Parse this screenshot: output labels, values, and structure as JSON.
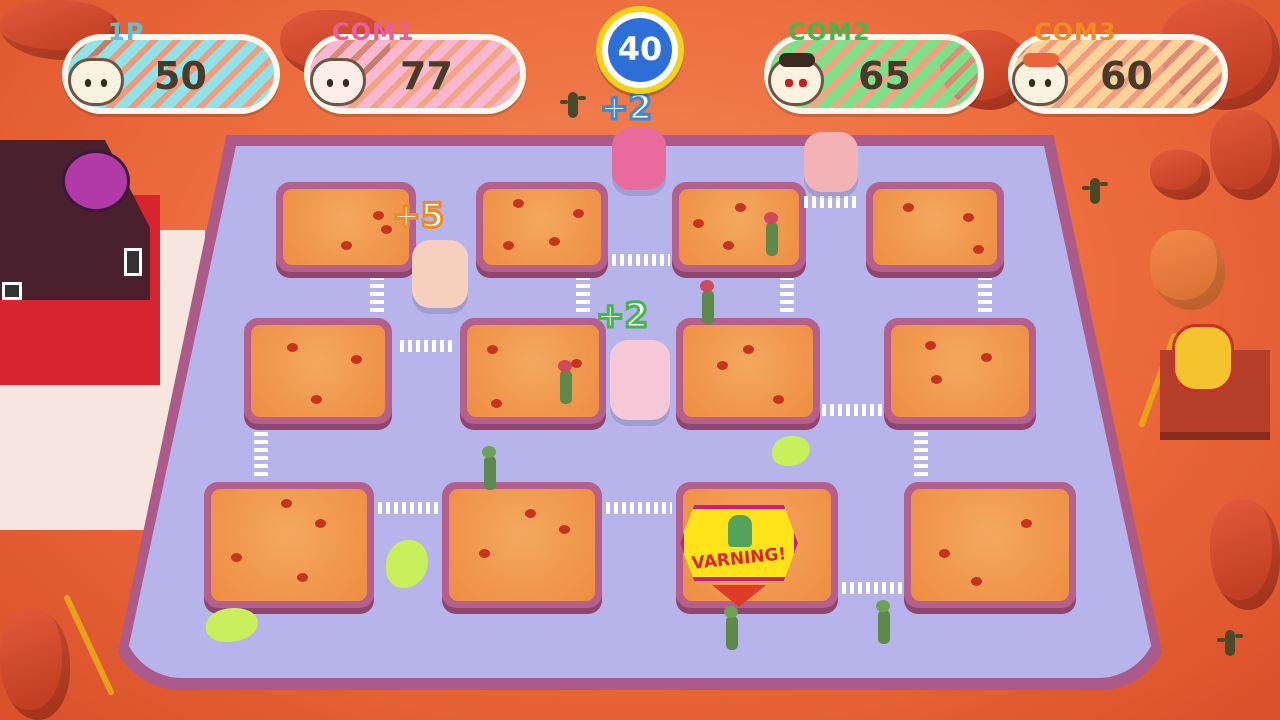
{
  "hud": {
    "players": [
      {
        "tag": "1P",
        "score": "50",
        "color": "#8fe3e8",
        "tag_color": "#5fbfd6"
      },
      {
        "tag": "COM1",
        "score": "77",
        "color": "#f8b8d0",
        "tag_color": "#ea5d9a"
      },
      {
        "tag": "COM2",
        "score": "65",
        "color": "#7fe08a",
        "tag_color": "#44b64a"
      },
      {
        "tag": "COM3",
        "score": "60",
        "color": "#ffd29a",
        "tag_color": "#f08a22"
      }
    ],
    "timer": "40"
  },
  "popups": {
    "top_center": "+2",
    "left": "+5",
    "center": "+2"
  },
  "warning": {
    "label": "VARNING!"
  }
}
